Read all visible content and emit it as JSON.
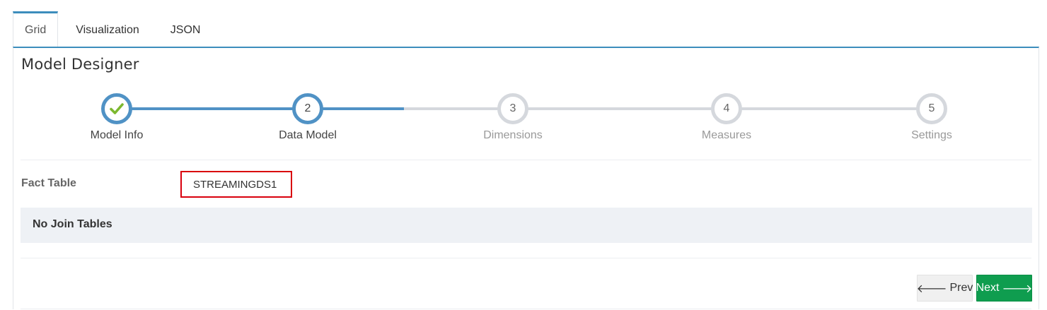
{
  "tabs": [
    {
      "label": "Grid",
      "active": true
    },
    {
      "label": "Visualization",
      "active": false
    },
    {
      "label": "JSON",
      "active": false
    }
  ],
  "panel": {
    "title": "Model Designer"
  },
  "stepper": {
    "current_step": 2,
    "steps": [
      {
        "number": "",
        "label": "Model Info",
        "state": "completed",
        "icon": "check-icon"
      },
      {
        "number": "2",
        "label": "Data Model",
        "state": "current"
      },
      {
        "number": "3",
        "label": "Dimensions",
        "state": "pending"
      },
      {
        "number": "4",
        "label": "Measures",
        "state": "pending"
      },
      {
        "number": "5",
        "label": "Settings",
        "state": "pending"
      }
    ]
  },
  "fact_table": {
    "label": "Fact Table",
    "value": "STREAMINGDS1"
  },
  "join_tables": {
    "message": "No Join Tables"
  },
  "buttons": {
    "prev_label": "Prev",
    "next_label": "Next"
  },
  "colors": {
    "accent": "#3c8dbc",
    "step_done": "#5092c5",
    "step_pending": "#d5d8dd",
    "check": "#7cb82f",
    "next_button": "#0f9d4f",
    "highlight_border": "#d9000d"
  }
}
